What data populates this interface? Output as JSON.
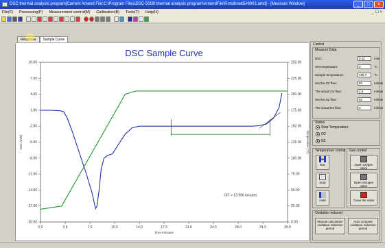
{
  "window": {
    "title": "DSC thermal analysis program[Current Amend File:C:\\Program Files\\DSC-500B thermal analysis program\\AmendFile\\Rmsitrowt5#8001.amd] - [Measure Window]",
    "minimize": "_",
    "maximize": "□",
    "close": "×"
  },
  "menu": {
    "items": [
      "File(F)",
      "Processing(P)",
      "Measurement control(M)",
      "Calibration(B)",
      "Tools(T)",
      "Help(H)"
    ],
    "right_controls": "_ ☐ ×"
  },
  "tabs": [
    {
      "label": "Response"
    },
    {
      "label": "Sample Curve"
    }
  ],
  "chart_data": {
    "type": "line",
    "title": "DSC Sample Curve",
    "xlabel": "Time /minutes",
    "ylabel_left": "DSC (mW)",
    "ylabel_right": "Temperature (°C)",
    "xlim": [
      0,
      35
    ],
    "ylim_left": [
      -20,
      10
    ],
    "ylim_right": [
      0,
      250
    ],
    "x_ticks": [
      "0.0",
      "3.5",
      "7.0",
      "10.5",
      "14.0",
      "17.5",
      "21.0",
      "24.5",
      "28.0",
      "31.5",
      "35.0"
    ],
    "y_ticks_left": [
      "10.00",
      "7.00",
      "4.00",
      "1.00",
      "-2.00",
      "-5.00",
      "-8.00",
      "-11.00",
      "-14.00",
      "-17.00",
      "-20.00"
    ],
    "y_ticks_right": [
      "250.00",
      "225.00",
      "200.00",
      "175.00",
      "150.00",
      "125.00",
      "100.00",
      "75.00",
      "50.00",
      "25.00",
      "0.00"
    ],
    "series": [
      {
        "color": "#1f2fb0",
        "axis": "left",
        "x": [
          0,
          1.5,
          2.8,
          3.3,
          3.8,
          4.5,
          5.5,
          6.5,
          7.3,
          7.8,
          8.0,
          8.3,
          8.6,
          9.0,
          9.5,
          10.2,
          11.0,
          12.0,
          13.0,
          14.0,
          15.5,
          17.5,
          20.0,
          23.0,
          26.0,
          28.0,
          30.0,
          31.0,
          32.0,
          33.0,
          33.8,
          34.2
        ],
        "y": [
          1.0,
          1.0,
          0.9,
          0.7,
          -0.5,
          -3.0,
          -7.0,
          -11.0,
          -14.5,
          -17.5,
          -17.0,
          -14.0,
          -10.0,
          -8.0,
          -7.5,
          -7.2,
          -5.5,
          -3.5,
          -2.3,
          -2.0,
          -2.0,
          -2.0,
          -2.0,
          -2.0,
          -2.0,
          -2.0,
          -2.0,
          -1.9,
          -1.6,
          -0.5,
          1.5,
          4.2
        ]
      },
      {
        "color": "#1f9a2f",
        "axis": "right",
        "x": [
          0,
          3.0,
          12.0,
          13.5,
          35.0
        ],
        "y": [
          20,
          25,
          200,
          205,
          205
        ]
      }
    ],
    "annotations": [
      {
        "text": "OIT = 13.996 minutes"
      }
    ]
  },
  "control": {
    "title": "Control",
    "measure_data_title": "Measure Data",
    "fields": [
      {
        "label": "DSC：",
        "value": "9.42",
        "unit": "mW"
      },
      {
        "label": "Set temperature:",
        "value": "0",
        "unit": "°C"
      },
      {
        "label": "Sample temperature:",
        "value": "199.7",
        "unit": "°C"
      },
      {
        "label": "Set the O2 flow:",
        "value": "50",
        "unit": "ml/min"
      },
      {
        "label": "The actual O2 flow:",
        "value": "2.5",
        "unit": "ml/min"
      },
      {
        "label": "Set the N2 flow:",
        "value": "50",
        "unit": "ml/min"
      },
      {
        "label": "The actual N2 flow:",
        "value": "0",
        "unit": "ml/min"
      }
    ],
    "status_title": "Status",
    "status_options": [
      {
        "label": "Stop Temperature",
        "selected": true
      },
      {
        "label": "O2",
        "selected": true
      },
      {
        "label": "N2",
        "selected": true
      }
    ],
    "temperature_control_title": "Temperature control",
    "gas_control_title": "Gas control",
    "temp_buttons": [
      "Run",
      "Stop",
      "Hold"
    ],
    "gas_buttons": [
      "Open oxygen valve",
      "Open nitrogen valve",
      "Close the valve"
    ],
    "oxidation_title": "Oxidation induced",
    "oxidation_buttons": [
      "Manual calculation oxidation induction period",
      "Auto compute oxidation induction period"
    ]
  }
}
